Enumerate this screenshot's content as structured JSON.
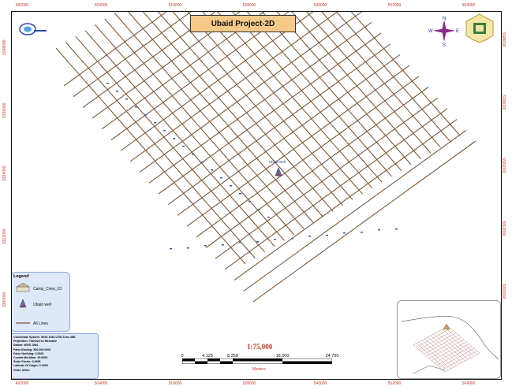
{
  "title": "Ubaid Project-2D",
  "top_ticks": [
    "492000",
    "504000",
    "516000",
    "528000",
    "540000",
    "552000",
    "564000"
  ],
  "bottom_ticks": [
    "492000",
    "504000",
    "516000",
    "528000",
    "540000",
    "552000",
    "564000"
  ],
  "left_ticks": [
    "3348000",
    "3336000",
    "3324000",
    "3312000",
    "3300000"
  ],
  "right_ticks": [
    "3348000",
    "3336000",
    "3324000",
    "3312000",
    "3300000"
  ],
  "compass": {
    "n": "N",
    "s": "S",
    "e": "E",
    "w": "W"
  },
  "legend": {
    "title": "Legend",
    "items": [
      "Camp_Crew_03",
      "Ubaid well",
      "All Lines"
    ]
  },
  "well_label": "Ubaid well",
  "coordinate_info": [
    "Coordinate System: WGS 1984 UTM Zone 38N",
    "Projection: Transverse Mercator",
    "Datum: WGS 1984",
    "False Easting: 500,000.0000",
    "False Northing: 0.0000",
    "Central Meridian: 45.0000",
    "Scale Factor: 0.9996",
    "Latitude Of Origin: 0.0000",
    "Units: Meter"
  ],
  "scale": {
    "ratio": "1:75,000",
    "labels": [
      "0",
      "4,125",
      "8,250",
      "16,500",
      "24,750"
    ],
    "unit": "Meters"
  },
  "colors": {
    "line": "#7a5a3c",
    "tick": "#c0392b",
    "title_bg": "#f4c98a",
    "legend_bg": "#dfe8f8"
  },
  "icons": [
    "company-logo-icon",
    "emblem-icon",
    "compass-rose-icon",
    "well-icon",
    "camp-icon"
  ]
}
